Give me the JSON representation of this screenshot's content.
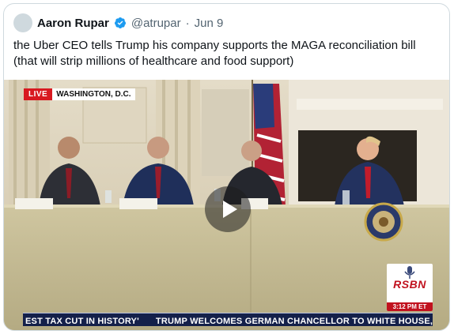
{
  "tweet": {
    "author_name": "Aaron Rupar",
    "handle": "@atrupar",
    "separator": "·",
    "date": "Jun 9",
    "text": "the Uber CEO tells Trump his company supports the MAGA reconciliation bill (that will strip millions of healthcare and food support)"
  },
  "video": {
    "live_label": "LIVE",
    "location": "WASHINGTON, D.C.",
    "channel_logo": "RSBN",
    "channel_time": "3:12 PM ET",
    "ticker_left": "EST TAX CUT IN HISTORY'",
    "ticker_right": "TRUMP WELCOMES GERMAN CHANCELLOR TO WHITE HOUSE, LOOKS",
    "play_icon": "play-icon"
  },
  "colors": {
    "verified_blue": "#1d9bf0",
    "live_red": "#d81920",
    "ticker_navy": "#14204a",
    "rsbn_red": "#c1121f"
  }
}
